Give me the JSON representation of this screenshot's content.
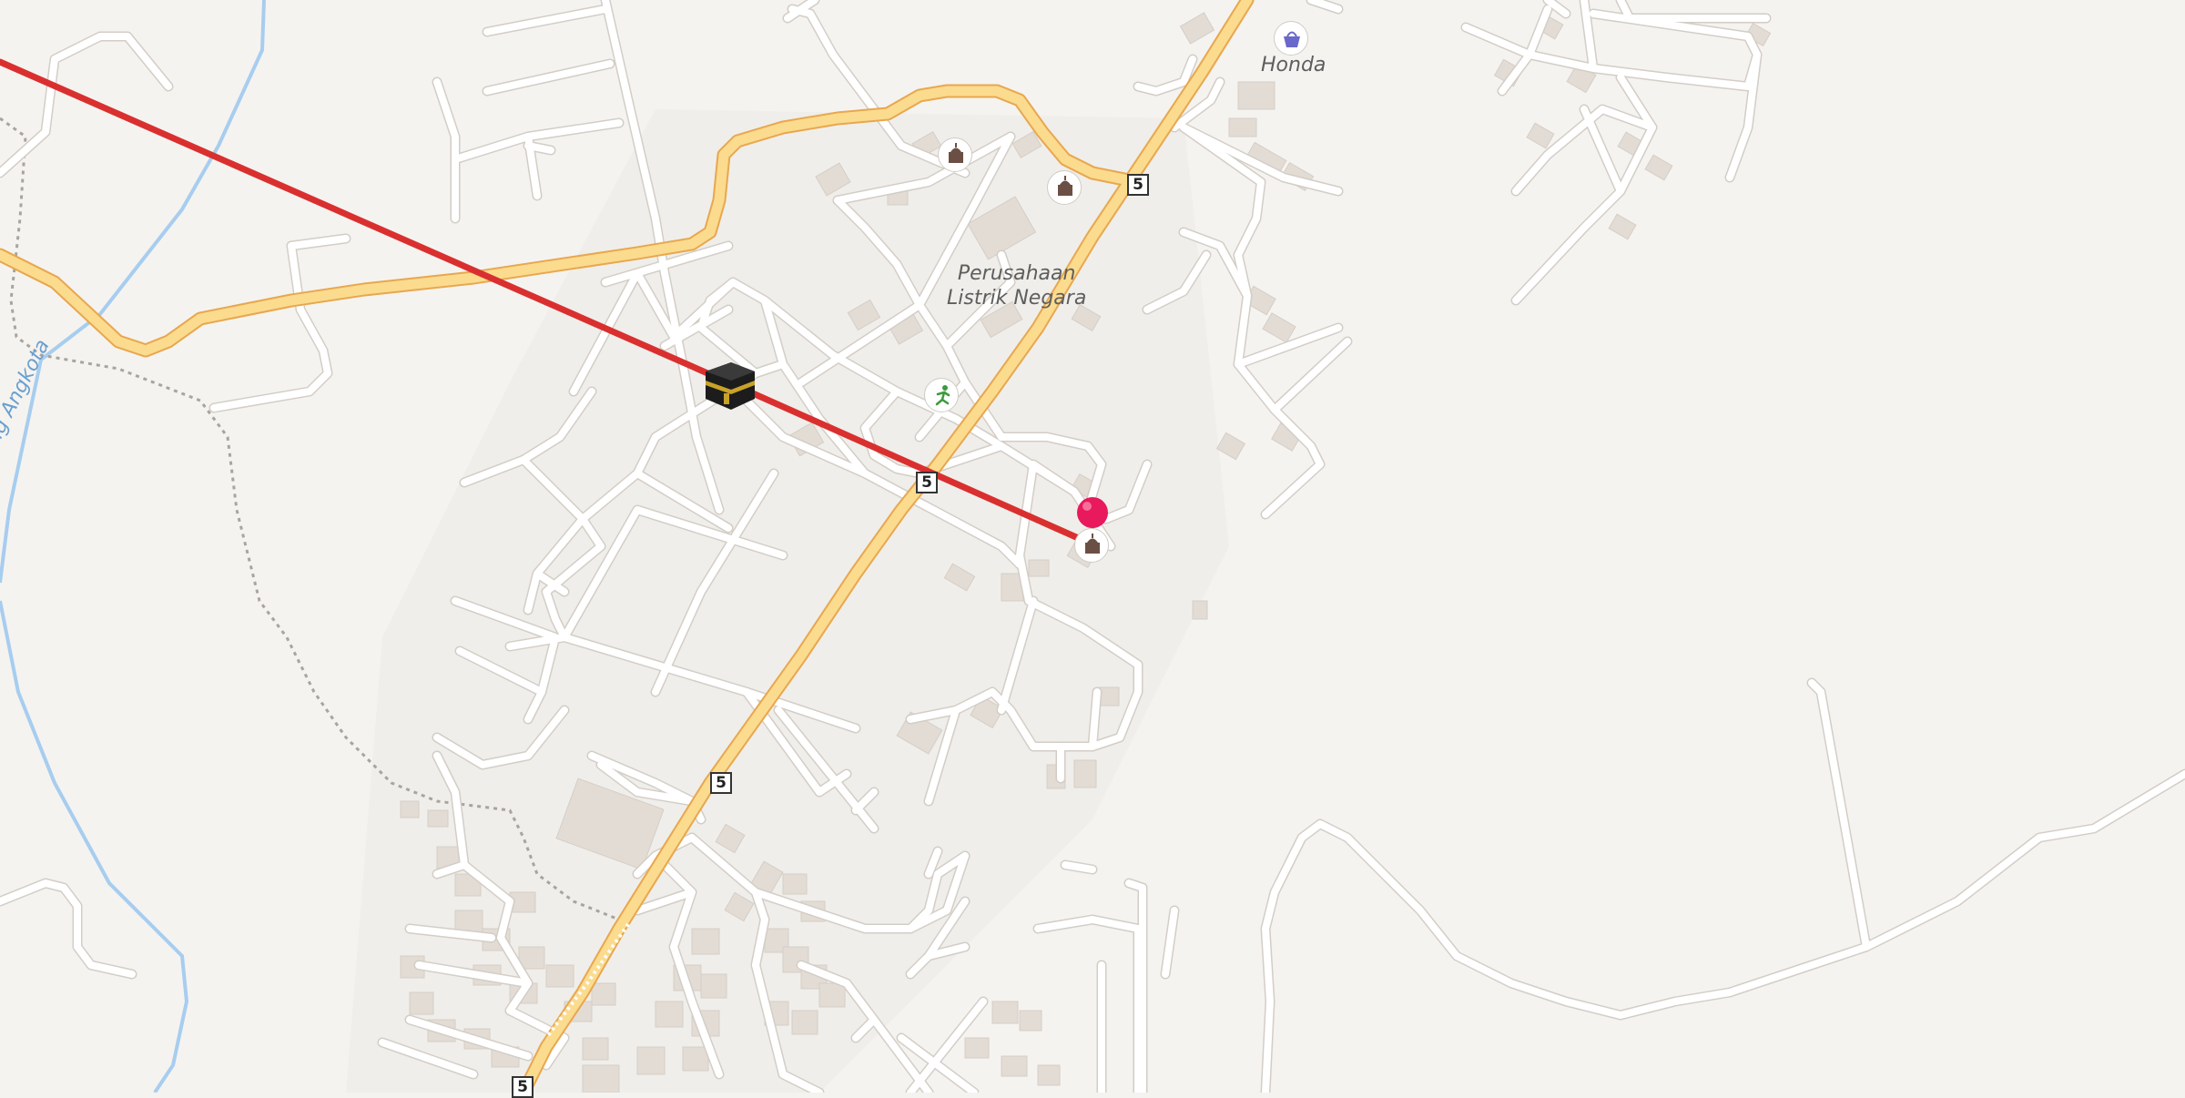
{
  "map": {
    "place_labels": {
      "pln": [
        "Perusahaan",
        "Listrik Negara"
      ],
      "honda": "Honda",
      "river": "Batang Angkota"
    },
    "road_ref": "5",
    "icons": {
      "mosque": "mosque-icon",
      "kaaba": "kaaba-icon",
      "shop": "shopping-basket-icon",
      "sport": "running-person-icon",
      "pin": "location-pin-icon"
    },
    "colors": {
      "background": "#f5f3f0",
      "primary_road": "#fbdb8e",
      "primary_road_casing": "#e8a74f",
      "river": "#a7cdef",
      "route": "#d9302f",
      "pin": "#e8195d"
    }
  }
}
